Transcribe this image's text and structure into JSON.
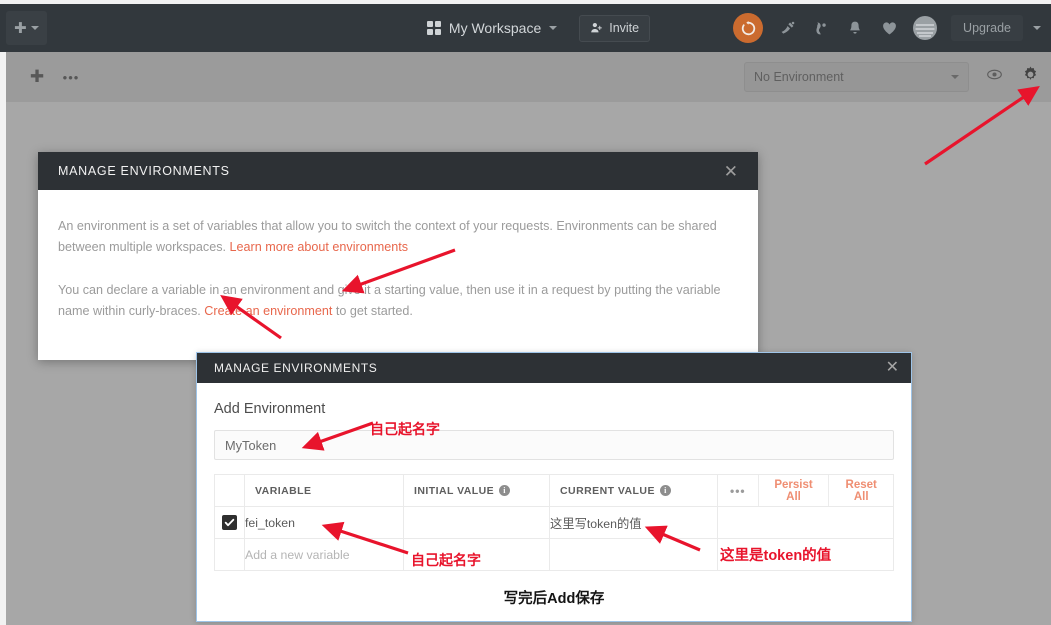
{
  "topbar": {
    "new_button": {
      "label": "",
      "icon": "plus-icon"
    },
    "workspace": {
      "label": "My Workspace",
      "icon": "grid-icon"
    },
    "invite": {
      "label": "Invite",
      "icon": "person-add-icon"
    },
    "sync": {
      "icon": "sync-icon"
    },
    "icons": [
      {
        "name": "satellite-icon"
      },
      {
        "name": "plugin-icon"
      },
      {
        "name": "bell-icon"
      },
      {
        "name": "heart-icon"
      },
      {
        "name": "avatar-icon"
      }
    ],
    "upgrade": {
      "label": "Upgrade"
    },
    "accent_orange": "#cb6b2f",
    "bar_bg": "#32383d"
  },
  "toolbar": {
    "new_icon": "plus-icon",
    "more_icon": "ellipsis-icon",
    "environment_select": {
      "value": "No Environment",
      "icon": "chevron-down-icon"
    },
    "eye_icon": "eye-icon",
    "gear_icon": "gear-icon"
  },
  "modal1": {
    "title": "MANAGE ENVIRONMENTS",
    "close_icon": "close-icon",
    "paragraph1_before": "An environment is a set of variables that allow you to switch the context of your requests. Environments can be shared between multiple workspaces. ",
    "paragraph1_link": "Learn more about environments",
    "paragraph2_before": "You can declare a variable in an environment and give it a starting value, then use it in a request by putting the variable name within curly-braces. ",
    "paragraph2_link": "Create an environment",
    "paragraph2_after": " to get started.",
    "link_color": "#e8674c"
  },
  "modal2": {
    "title": "MANAGE ENVIRONMENTS",
    "close_icon": "close-icon",
    "section_label": "Add Environment",
    "env_name_value": "MyToken",
    "table": {
      "headers": {
        "variable": "VARIABLE",
        "initial_value": "INITIAL VALUE",
        "current_value": "CURRENT VALUE"
      },
      "info_glyph": "i",
      "actions": {
        "more_icon": "ellipsis-icon",
        "persist_all": "Persist All",
        "reset_all": "Reset All"
      },
      "rows": [
        {
          "checked": true,
          "variable": "fei_token",
          "initial_value": "",
          "current_value": "这里写token的值"
        }
      ],
      "new_row_placeholder": "Add a new variable"
    },
    "bottom_note": "写完后Add保存",
    "border_color": "#9ec4e8"
  },
  "annotations": {
    "color": "#e8142c",
    "name_label_top": "自己起名字",
    "name_label_bottom": "自己起名字",
    "token_value_label": "这里是token的值"
  }
}
